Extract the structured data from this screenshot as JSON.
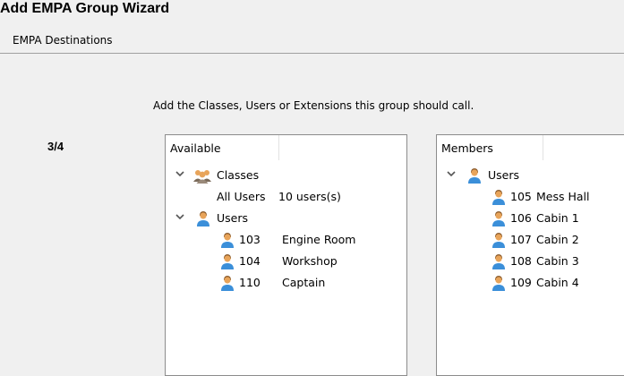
{
  "window": {
    "title": "Add EMPA Group Wizard",
    "subtitle": "EMPA Destinations",
    "instruction": "Add the Classes, Users or Extensions this group should call.",
    "step": "3/4"
  },
  "available": {
    "header": "Available",
    "groups": [
      {
        "label": "Classes",
        "icon": "group-users-icon",
        "items": [
          {
            "label": "All Users",
            "value": "10 users(s)"
          }
        ]
      },
      {
        "label": "Users",
        "icon": "user-icon",
        "items": [
          {
            "number": "103",
            "name": "Engine Room"
          },
          {
            "number": "104",
            "name": "Workshop"
          },
          {
            "number": "110",
            "name": "Captain"
          }
        ]
      }
    ]
  },
  "members": {
    "header": "Members",
    "groups": [
      {
        "label": "Users",
        "icon": "user-icon",
        "items": [
          {
            "number": "105",
            "name": "Mess Hall"
          },
          {
            "number": "106",
            "name": "Cabin 1"
          },
          {
            "number": "107",
            "name": "Cabin 2"
          },
          {
            "number": "108",
            "name": "Cabin 3"
          },
          {
            "number": "109",
            "name": "Cabin 4"
          }
        ]
      }
    ]
  },
  "colors": {
    "user_shirt": "#3b8fd9",
    "user_head": "#e8a45a",
    "user_hair": "#8a5a2b"
  }
}
